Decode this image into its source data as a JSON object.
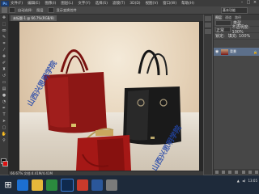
{
  "app": {
    "logo_text": "Ps"
  },
  "menu": {
    "items": [
      "文件(F)",
      "编辑(E)",
      "图像(I)",
      "图层(L)",
      "文字(Y)",
      "选择(S)",
      "滤镜(T)",
      "3D(D)",
      "视图(V)",
      "窗口(W)",
      "帮助(H)"
    ]
  },
  "options": {
    "items": [
      "自动选择:",
      "图层",
      "显示变换控件"
    ],
    "workspace": "基本功能"
  },
  "document": {
    "tab_title": "未标题-1 @ 66.7%(RGB/8)"
  },
  "watermarks": [
    "山西兴思明学院",
    "山西兴思明学院"
  ],
  "status": {
    "text": "66.67%   文档:4.41M/4.41M"
  },
  "panel": {
    "tabs": [
      "图层",
      "通道",
      "路径"
    ],
    "kind_label": "类型",
    "blend_mode": "正常",
    "opacity_label": "不透明度: 100%",
    "lock_label": "锁定:",
    "fill_label": "填充: 100%",
    "layer_name": "背景",
    "layer_lock": "🔒"
  },
  "colors": {
    "foreground": "#000000",
    "background": "#dd1111",
    "layer_selected": "#5c6f8a"
  },
  "taskbar": {
    "apps": [
      {
        "name": "ie",
        "color": "#1c6fd1"
      },
      {
        "name": "explorer",
        "color": "#e6b83a"
      },
      {
        "name": "media",
        "color": "#2b8a3e"
      },
      {
        "name": "photoshop",
        "color": "#0f2a4e"
      },
      {
        "name": "browser",
        "color": "#c93a2b"
      },
      {
        "name": "word",
        "color": "#2b579a"
      },
      {
        "name": "app7",
        "color": "#7a7a7a"
      }
    ],
    "tray_time": "13:05"
  }
}
